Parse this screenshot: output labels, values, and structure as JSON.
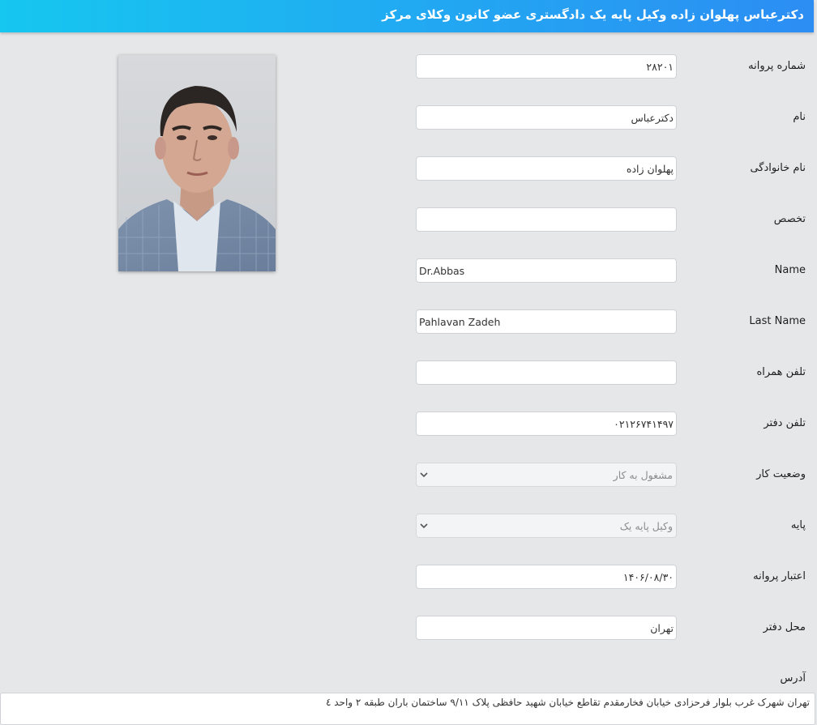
{
  "header": {
    "title": "دکترعباس پهلوان زاده وکیل پایه یک دادگستری عضو کانون وکلای مرکز"
  },
  "photo": {
    "subject": "lawyer-portrait"
  },
  "fields": {
    "license_number": {
      "label": "شماره پروانه",
      "value": "۲۸۲۰۱"
    },
    "first_name": {
      "label": "نام",
      "value": "دکترعباس"
    },
    "last_name": {
      "label": "نام خانوادگی",
      "value": "پهلوان زاده"
    },
    "specialty": {
      "label": "تخصص",
      "value": ""
    },
    "name_en": {
      "label": "Name",
      "value": "Dr.Abbas"
    },
    "last_name_en": {
      "label": "Last Name",
      "value": "Pahlavan Zadeh"
    },
    "mobile": {
      "label": "تلفن همراه",
      "value": ""
    },
    "office_phone": {
      "label": "تلفن دفتر",
      "value": "۰۲۱۲۶۷۴۱۴۹۷"
    },
    "work_status": {
      "label": "وضعیت کار",
      "value": "مشغول به کار"
    },
    "grade": {
      "label": "پایه",
      "value": "وکیل پایه یک"
    },
    "license_validity": {
      "label": "اعتبار پروانه",
      "value": "۱۴۰۶/۰۸/۳۰"
    },
    "office_location": {
      "label": "محل دفتر",
      "value": "تهران"
    },
    "address": {
      "label": "آدرس",
      "value": "تهران شهرک غرب بلوار فرحزادی خیابان فخارمقدم تقاطع خیابان شهید حافظی پلاک ۹/۱۱ ساختمان باران طبقه ۲ واحد ٤"
    }
  },
  "colors": {
    "header_start": "#16c7f0",
    "header_end": "#2c8df3",
    "background": "#e6e7e9"
  }
}
